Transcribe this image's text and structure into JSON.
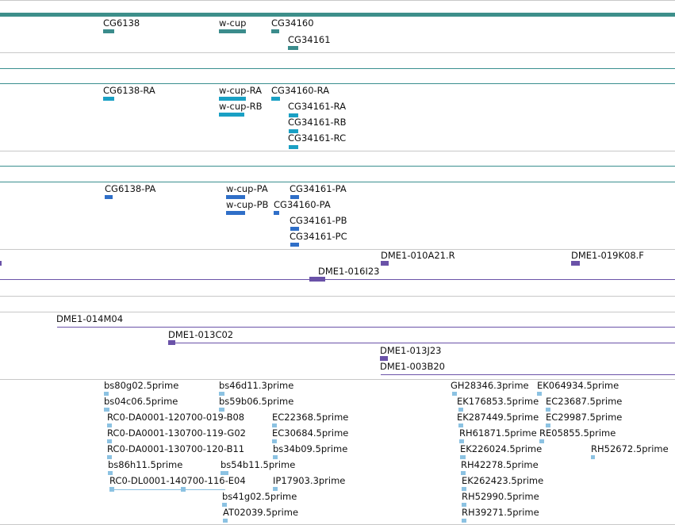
{
  "tracks": {
    "genes": [
      {
        "name": "CG6138"
      },
      {
        "name": "w-cup"
      },
      {
        "name": "CG34160"
      },
      {
        "name": "CG34161"
      }
    ],
    "transcripts": [
      {
        "name": "CG6138-RA"
      },
      {
        "name": "w-cup-RA"
      },
      {
        "name": "w-cup-RB"
      },
      {
        "name": "CG34160-RA"
      },
      {
        "name": "CG34161-RA"
      },
      {
        "name": "CG34161-RB"
      },
      {
        "name": "CG34161-RC"
      }
    ],
    "proteins": [
      {
        "name": "CG6138-PA"
      },
      {
        "name": "w-cup-PA"
      },
      {
        "name": "w-cup-PB"
      },
      {
        "name": "CG34160-PA"
      },
      {
        "name": "CG34161-PA"
      },
      {
        "name": "CG34161-PB"
      },
      {
        "name": "CG34161-PC"
      }
    ],
    "bacs_upper": [
      {
        "name": "DME1-010A21.R"
      },
      {
        "name": "DME1-019K08.F"
      },
      {
        "name": "DME1-016I23"
      }
    ],
    "bacs_lower": [
      {
        "name": "DME1-014M04"
      },
      {
        "name": "DME1-013C02"
      },
      {
        "name": "DME1-013J23"
      },
      {
        "name": "DME1-003B20"
      }
    ],
    "ests": [
      {
        "name": "bs80g02.5prime"
      },
      {
        "name": "bs46d11.3prime"
      },
      {
        "name": "GH28346.3prime"
      },
      {
        "name": "EK064934.5prime"
      },
      {
        "name": "bs04c06.5prime"
      },
      {
        "name": "bs59b06.5prime"
      },
      {
        "name": "EK176853.5prime"
      },
      {
        "name": "EC23687.5prime"
      },
      {
        "name": "RC0-DA0001-120700-019-B08"
      },
      {
        "name": "EC22368.5prime"
      },
      {
        "name": "EK287449.5prime"
      },
      {
        "name": "EC29987.5prime"
      },
      {
        "name": "RC0-DA0001-130700-119-G02"
      },
      {
        "name": "EC30684.5prime"
      },
      {
        "name": "RH61871.5prime"
      },
      {
        "name": "RE05855.5prime"
      },
      {
        "name": "RC0-DA0001-130700-120-B11"
      },
      {
        "name": "bs34b09.5prime"
      },
      {
        "name": "EK226024.5prime"
      },
      {
        "name": "RH52672.5prime"
      },
      {
        "name": "bs86h11.5prime"
      },
      {
        "name": "bs54b11.5prime"
      },
      {
        "name": "RH42278.5prime"
      },
      {
        "name": "RC0-DL0001-140700-116-E04"
      },
      {
        "name": "IP17903.3prime"
      },
      {
        "name": "EK262423.5prime"
      },
      {
        "name": "bs41g02.5prime"
      },
      {
        "name": "RH52990.5prime"
      },
      {
        "name": "AT02039.5prime"
      },
      {
        "name": "RH39271.5prime"
      }
    ]
  },
  "colors": {
    "gene": "#3b8c8c",
    "transcript": "#1aa0c4",
    "protein": "#2f6fc8",
    "bac": "#6a52a8",
    "est": "#8cc2e2",
    "track_line": "#3a8f8f",
    "separator": "#c8c8c8"
  }
}
